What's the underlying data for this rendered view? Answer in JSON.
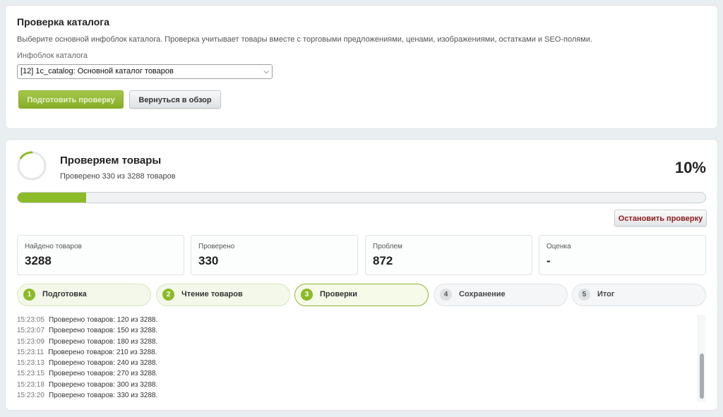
{
  "catalog_check": {
    "title": "Проверка каталога",
    "description": "Выберите основной инфоблок каталога. Проверка учитывает товары вместе с торговыми предложениями, ценами, изображениями, остатками и SEO-полями.",
    "field_label": "Инфоблок каталога",
    "selected_iblock": "[12] 1c_catalog: Основной каталог товаров",
    "prepare_label": "Подготовить проверку",
    "back_label": "Вернуться в обзор"
  },
  "progress": {
    "title": "Проверяем товары",
    "subtitle": "Проверено 330 из 3288 товаров",
    "percent_label": "10%",
    "percent_value": 10,
    "stop_label": "Остановить проверку"
  },
  "stats": [
    {
      "label": "Найдено товаров",
      "value": "3288"
    },
    {
      "label": "Проверено",
      "value": "330"
    },
    {
      "label": "Проблем",
      "value": "872"
    },
    {
      "label": "Оценка",
      "value": "-"
    }
  ],
  "steps": [
    {
      "num": "1",
      "label": "Подготовка",
      "state": "done"
    },
    {
      "num": "2",
      "label": "Чтение товаров",
      "state": "done"
    },
    {
      "num": "3",
      "label": "Проверки",
      "state": "active"
    },
    {
      "num": "4",
      "label": "Сохранение",
      "state": "pending"
    },
    {
      "num": "5",
      "label": "Итог",
      "state": "pending"
    }
  ],
  "log": [
    {
      "time": "15:23:05",
      "text": "Проверено товаров: 120 из 3288."
    },
    {
      "time": "15:23:07",
      "text": "Проверено товаров: 150 из 3288."
    },
    {
      "time": "15:23:09",
      "text": "Проверено товаров: 180 из 3288."
    },
    {
      "time": "15:23:11",
      "text": "Проверено товаров: 210 из 3288."
    },
    {
      "time": "15:23:13",
      "text": "Проверено товаров: 240 из 3288."
    },
    {
      "time": "15:23:15",
      "text": "Проверено товаров: 270 из 3288."
    },
    {
      "time": "15:23:18",
      "text": "Проверено товаров: 300 из 3288."
    },
    {
      "time": "15:23:20",
      "text": "Проверено товаров: 330 из 3288."
    }
  ],
  "colors": {
    "accent": "#8bbb27",
    "stop_text": "#8b1a1a"
  }
}
